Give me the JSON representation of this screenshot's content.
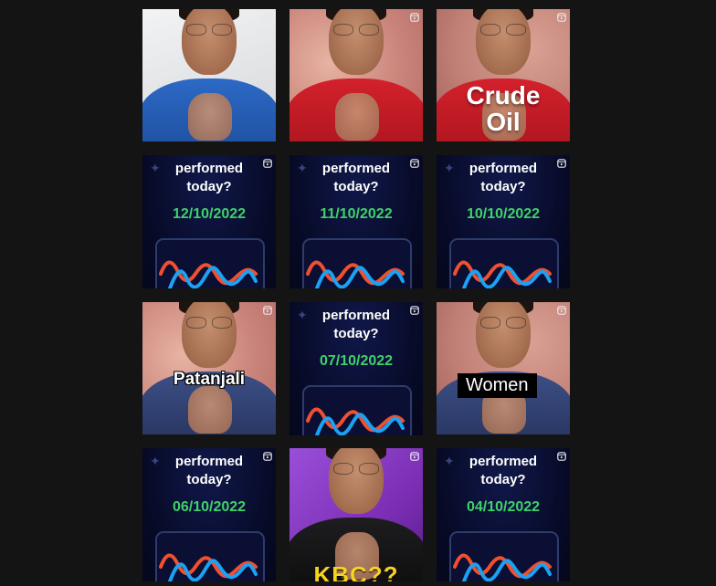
{
  "grid": {
    "tiles": [
      {
        "kind": "video",
        "bg": "bg-white",
        "body": "body-blue",
        "overlay": "",
        "overlay_style": ""
      },
      {
        "kind": "video",
        "bg": "bg-pink",
        "body": "body-red",
        "overlay": "",
        "overlay_style": ""
      },
      {
        "kind": "video",
        "bg": "bg-pink2",
        "body": "body-red",
        "overlay": "Crude Oil",
        "overlay_style": "overlay-crude"
      },
      {
        "kind": "clip",
        "caption": "performed today?",
        "date": "12/10/2022"
      },
      {
        "kind": "clip",
        "caption": "performed today?",
        "date": "11/10/2022"
      },
      {
        "kind": "clip",
        "caption": "performed today?",
        "date": "10/10/2022"
      },
      {
        "kind": "video",
        "bg": "bg-pink",
        "body": "body-navy",
        "overlay": "Patanjali",
        "overlay_style": "overlay-patanjali"
      },
      {
        "kind": "clip",
        "caption": "performed today?",
        "date": "07/10/2022"
      },
      {
        "kind": "video",
        "bg": "bg-pink2",
        "body": "body-navy",
        "overlay": "Women",
        "overlay_style": "overlay-women"
      },
      {
        "kind": "clip",
        "caption": "performed today?",
        "date": "06/10/2022"
      },
      {
        "kind": "video",
        "bg": "bg-purple",
        "body": "body-black",
        "overlay": "KBC??",
        "overlay_style": "overlay-kbc"
      },
      {
        "kind": "clip",
        "caption": "performed today?",
        "date": "04/10/2022"
      }
    ]
  },
  "icons": {
    "reel": "reel-icon"
  },
  "colors": {
    "page_background": "#141414",
    "date_green": "#3fd16a",
    "chart_red": "#f0502f",
    "chart_blue": "#1da1f2",
    "clip_background": "#070a26"
  }
}
